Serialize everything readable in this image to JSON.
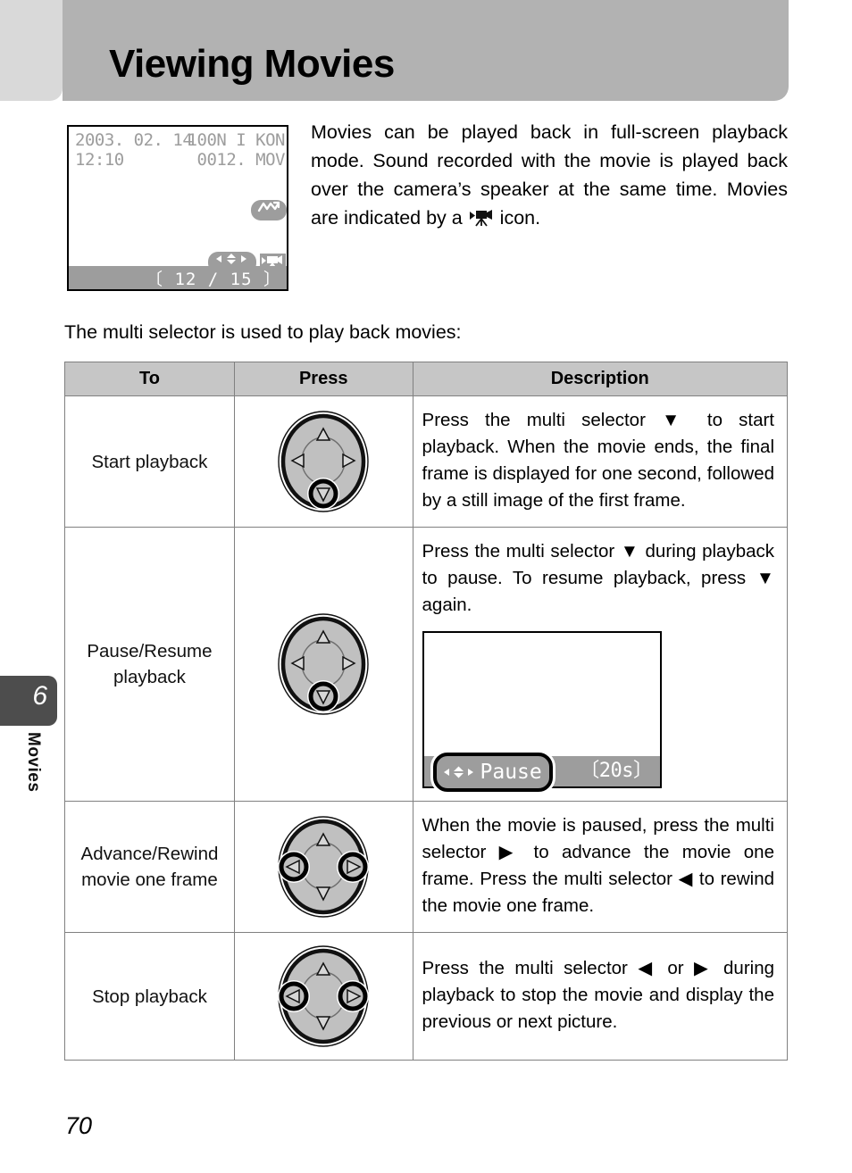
{
  "header": {
    "title": "Viewing Movies"
  },
  "chapter_tab": {
    "number": "6",
    "label": "Movies"
  },
  "lcd_intro": {
    "date": "2003. 02. 14",
    "time": "12:10",
    "folder": "100N I KON",
    "file": "0012. MOV",
    "sound_badge_icon": "sound-waveform-icon",
    "nav_pill_icon": "multi-selector-arrows-icon",
    "movie_icon": "movie-camera-icon",
    "counter": "〔 12 / 15 〕"
  },
  "intro_paragraph": {
    "part1": "Movies can be played back in full-screen playback mode. Sound recorded with the movie is played back over the camera’s speaker at the same time. Movies are indicated by a ",
    "icon": "movie-camera-icon",
    "part2": " icon."
  },
  "lead_line": "The multi selector is used to play back movies:",
  "table": {
    "headers": [
      "To",
      "Press",
      "Description"
    ],
    "rows": [
      {
        "to": "Start playback",
        "press_icon": "multi-selector-down-highlighted",
        "highlight": [
          "down"
        ],
        "description": "Press the multi selector ▼ to start playback. When the movie ends, the final frame is displayed for one second, followed by a still image of the first frame."
      },
      {
        "to": "Pause/Resume playback",
        "press_icon": "multi-selector-down-highlighted",
        "highlight": [
          "down"
        ],
        "description": "Press the multi selector ▼ during playback to pause. To resume playback, press ▼ again.",
        "lcd_pause": {
          "arrows": "◀▲▼▶",
          "label": "Pause",
          "time": "〔20s〕"
        }
      },
      {
        "to": "Advance/Rewind movie one frame",
        "press_icon": "multi-selector-left-right-highlighted",
        "highlight": [
          "left",
          "right"
        ],
        "description": "When the movie is paused, press the multi selector ▶ to advance the movie one frame. Press the multi selector ◀ to rewind the movie one frame."
      },
      {
        "to": "Stop playback",
        "press_icon": "multi-selector-left-right-highlighted",
        "highlight": [
          "left",
          "right"
        ],
        "description": "Press the multi selector ◀ or ▶ during playback to stop the movie and display the previous or next picture."
      }
    ]
  },
  "page_number": "70",
  "colors": {
    "header_bar": "#b2b2b2",
    "tab_strip": "#d9d9d9",
    "chapter_tab": "#4d4d4d",
    "table_header": "#c6c6c6",
    "table_border": "#808080",
    "lcd_gray": "#9d9d9d",
    "dial_fill": "#c0c0c0"
  }
}
